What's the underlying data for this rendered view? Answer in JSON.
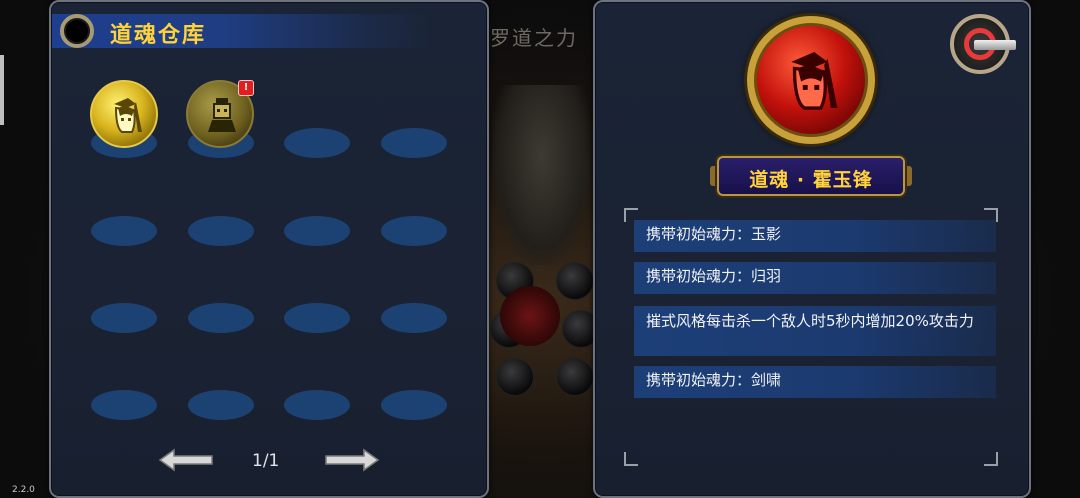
{
  "version": "2.2.0",
  "background": {
    "title": "修罗道之力"
  },
  "warehouse": {
    "title": "道魂仓库",
    "souls": [
      {
        "name": "gold-soul",
        "state": "normal",
        "color": "#e0c024"
      },
      {
        "name": "dim-gold-soul",
        "state": "new",
        "badge": "!",
        "color": "#8a7b2c"
      }
    ],
    "pager": {
      "page": "1/1"
    }
  },
  "detail": {
    "name": "道魂 · 霍玉锋",
    "properties": [
      "携带初始魂力：玉影",
      "携带初始魂力：归羽",
      "摧式风格每击杀一个敌人时5秒内增加20%攻击力",
      "携带初始魂力：剑啸"
    ]
  }
}
